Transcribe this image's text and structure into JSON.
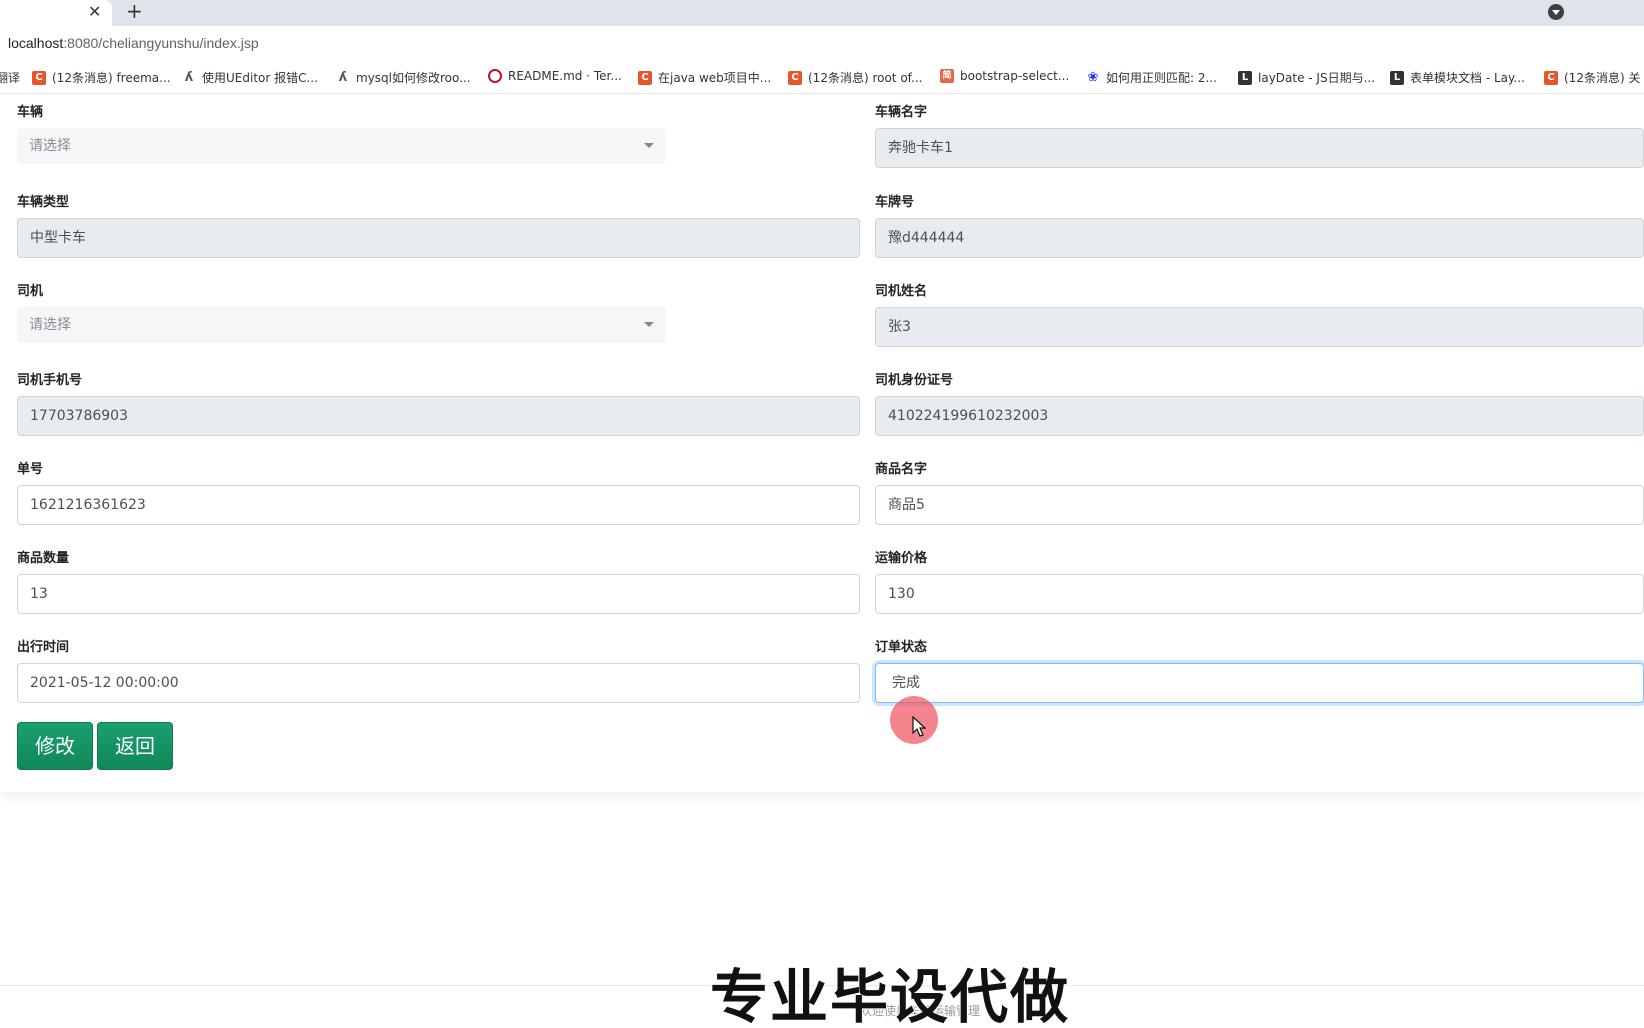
{
  "browser": {
    "tab_close": "✕",
    "new_tab": "+",
    "url_host": "localhost",
    "url_path": ":8080/cheliangyunshu/index.jsp",
    "bookmarks": [
      {
        "label": "翻译",
        "icon": "none"
      },
      {
        "label": "(12条消息) freema...",
        "icon": "csdn-icon"
      },
      {
        "label": "使用UEditor 报错C...",
        "icon": "ueditor-icon"
      },
      {
        "label": "mysql如何修改roo...",
        "icon": "ueditor-icon"
      },
      {
        "label": "README.md · Ter...",
        "icon": "gitee-icon"
      },
      {
        "label": "在java web项目中...",
        "icon": "csdn-icon"
      },
      {
        "label": "(12条消息) root of...",
        "icon": "csdn-icon"
      },
      {
        "label": "bootstrap-select...",
        "icon": "jianshu-icon"
      },
      {
        "label": "如何用正则匹配: 2...",
        "icon": "baidu-paw-icon"
      },
      {
        "label": "layDate - JS日期与...",
        "icon": "layui-icon"
      },
      {
        "label": "表单模块文档 - Lay...",
        "icon": "layui-icon"
      },
      {
        "label": "(12条消息) 关",
        "icon": "csdn-icon"
      }
    ]
  },
  "form": {
    "vehicle": {
      "label": "车辆",
      "placeholder": "请选择"
    },
    "vehicle_name": {
      "label": "车辆名字",
      "value": "奔驰卡车1"
    },
    "vehicle_type": {
      "label": "车辆类型",
      "value": "中型卡车"
    },
    "plate_number": {
      "label": "车牌号",
      "value": "豫d444444"
    },
    "driver": {
      "label": "司机",
      "placeholder": "请选择"
    },
    "driver_name": {
      "label": "司机姓名",
      "value": "张3"
    },
    "driver_phone": {
      "label": "司机手机号",
      "value": "17703786903"
    },
    "driver_id": {
      "label": "司机身份证号",
      "value": "410224199610232003"
    },
    "order_no": {
      "label": "单号",
      "value": "1621216361623"
    },
    "goods_name": {
      "label": "商品名字",
      "value": "商品5"
    },
    "goods_qty": {
      "label": "商品数量",
      "value": "13"
    },
    "freight_price": {
      "label": "运输价格",
      "value": "130"
    },
    "depart_time": {
      "label": "出行时间",
      "value": "2021-05-12 00:00:00"
    },
    "order_status": {
      "label": "订单状态",
      "value": "完成"
    },
    "submit_label": "修改",
    "back_label": "返回"
  },
  "overlay": {
    "watermark": "专业毕设代做",
    "footer_text": "欢迎使用车辆运输管理"
  },
  "colors": {
    "button_green": "#11875a",
    "cursor_halo": "#ee4452"
  }
}
